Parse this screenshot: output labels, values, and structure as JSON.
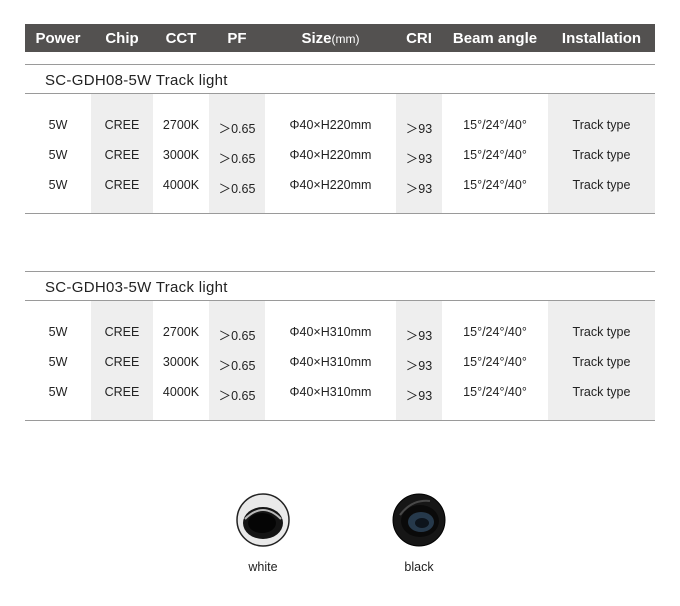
{
  "header": {
    "power": "Power",
    "chip": "Chip",
    "cct": "CCT",
    "pf": "PF",
    "size": "Size",
    "size_unit": "(mm)",
    "cri": "CRI",
    "beam_angle": "Beam angle",
    "installation": "Installation"
  },
  "sections": [
    {
      "title": "SC-GDH08-5W   Track light",
      "rows": [
        {
          "power": "5W",
          "chip": "CREE",
          "cct": "2700K",
          "pf": "＞0.65",
          "size": "Φ40×H220mm",
          "cri": "＞93",
          "beam_angle": "15°/24°/40°",
          "installation": "Track type"
        },
        {
          "power": "5W",
          "chip": "CREE",
          "cct": "3000K",
          "pf": "＞0.65",
          "size": "Φ40×H220mm",
          "cri": "＞93",
          "beam_angle": "15°/24°/40°",
          "installation": "Track type"
        },
        {
          "power": "5W",
          "chip": "CREE",
          "cct": "4000K",
          "pf": "＞0.65",
          "size": "Φ40×H220mm",
          "cri": "＞93",
          "beam_angle": "15°/24°/40°",
          "installation": "Track type"
        }
      ]
    },
    {
      "title": "SC-GDH03-5W   Track light",
      "rows": [
        {
          "power": "5W",
          "chip": "CREE",
          "cct": "2700K",
          "pf": "＞0.65",
          "size": "Φ40×H310mm",
          "cri": "＞93",
          "beam_angle": "15°/24°/40°",
          "installation": "Track type"
        },
        {
          "power": "5W",
          "chip": "CREE",
          "cct": "3000K",
          "pf": "＞0.65",
          "size": "Φ40×H310mm",
          "cri": "＞93",
          "beam_angle": "15°/24°/40°",
          "installation": "Track type"
        },
        {
          "power": "5W",
          "chip": "CREE",
          "cct": "4000K",
          "pf": "＞0.65",
          "size": "Φ40×H310mm",
          "cri": "＞93",
          "beam_angle": "15°/24°/40°",
          "installation": "Track type"
        }
      ]
    }
  ],
  "colors": [
    {
      "label": "white",
      "body_color": "#e6e6e6",
      "inner_color": "#111111"
    },
    {
      "label": "black",
      "body_color": "#151515",
      "inner_color": "#2a3a4a"
    }
  ]
}
